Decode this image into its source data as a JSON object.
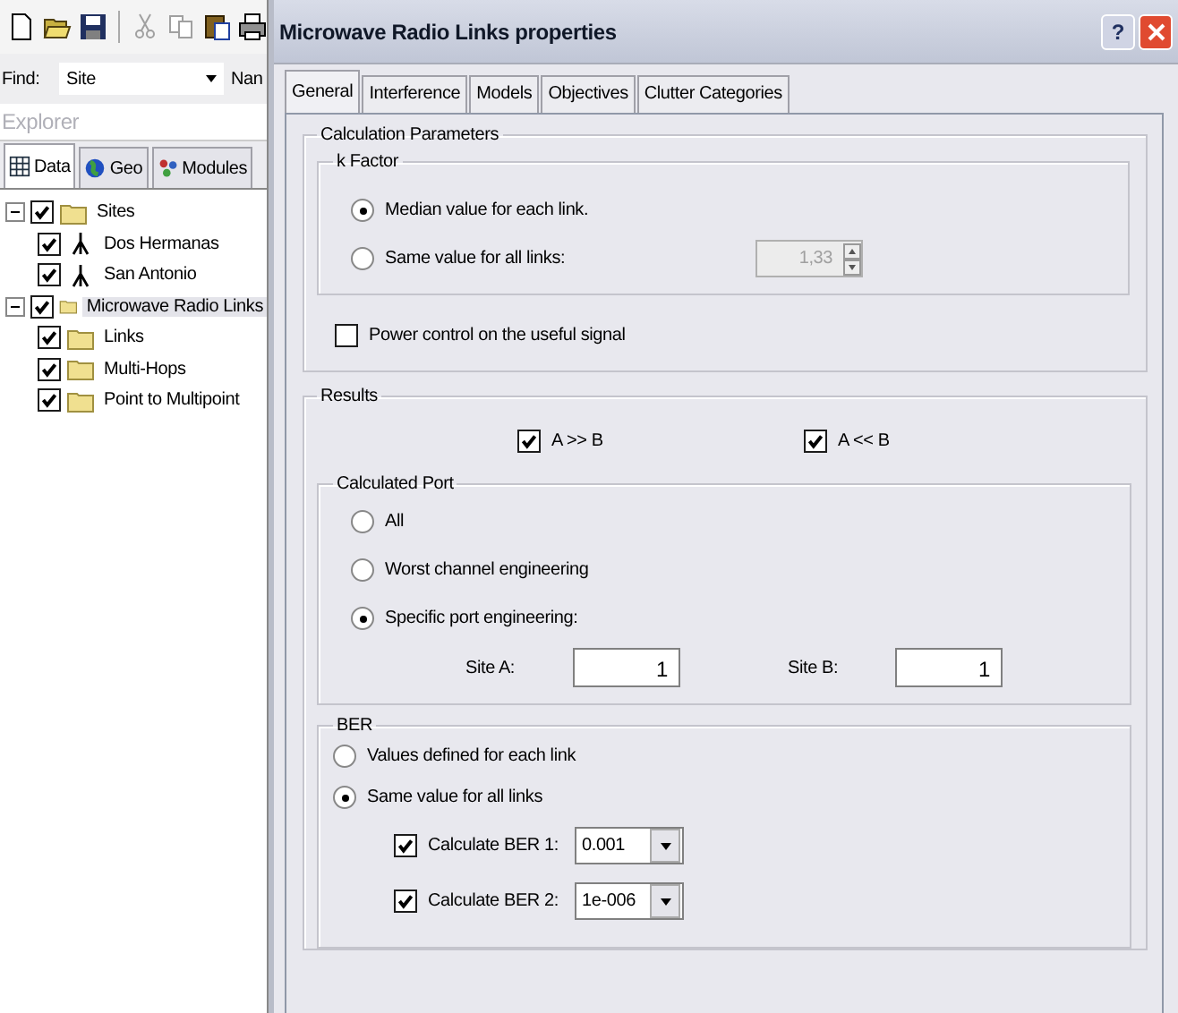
{
  "explorer": {
    "find": {
      "label": "Find:",
      "value": "Site"
    },
    "column_2_label": "Nan",
    "title": "Explorer",
    "tabs": [
      {
        "label": "Data",
        "selected": true
      },
      {
        "label": "Geo",
        "selected": false
      },
      {
        "label": "Modules",
        "selected": false
      }
    ],
    "tree": [
      {
        "label": "Sites",
        "kind": "folder",
        "checked": true,
        "expanded": true,
        "selected": false,
        "children": [
          {
            "label": "Dos Hermanas",
            "kind": "site",
            "checked": true,
            "selected": false
          },
          {
            "label": "San Antonio",
            "kind": "site",
            "checked": true,
            "selected": false
          }
        ]
      },
      {
        "label": "Microwave Radio Links",
        "kind": "folder",
        "checked": true,
        "expanded": true,
        "selected": true,
        "children": [
          {
            "label": "Links",
            "kind": "folder",
            "checked": true,
            "selected": false
          },
          {
            "label": "Multi-Hops",
            "kind": "folder",
            "checked": true,
            "selected": false
          },
          {
            "label": "Point to Multipoint",
            "kind": "folder",
            "checked": true,
            "selected": false
          }
        ]
      }
    ]
  },
  "dialog": {
    "title": "Microwave Radio Links properties",
    "help_button": "?",
    "tabs": [
      {
        "label": "General",
        "selected": true
      },
      {
        "label": "Interference",
        "selected": false
      },
      {
        "label": "Models",
        "selected": false
      },
      {
        "label": "Objectives",
        "selected": false
      },
      {
        "label": "Clutter Categories",
        "selected": false
      }
    ],
    "calculation_parameters": {
      "title": "Calculation Parameters",
      "k_factor": {
        "title": "k Factor",
        "options": [
          {
            "label": "Median value for each link.",
            "selected": true
          },
          {
            "label": "Same value for all links:",
            "selected": false
          }
        ],
        "spinner": {
          "value": "1,33",
          "disabled": true
        }
      },
      "power_control": {
        "label": "Power control on the useful signal",
        "checked": false
      }
    },
    "results": {
      "title": "Results",
      "directions": [
        {
          "label": "A >> B",
          "checked": true
        },
        {
          "label": "A << B",
          "checked": true
        }
      ],
      "calculated_port": {
        "title": "Calculated Port",
        "options": [
          {
            "label": "All",
            "selected": false
          },
          {
            "label": "Worst channel engineering",
            "selected": false
          },
          {
            "label": "Specific port engineering:",
            "selected": true
          }
        ],
        "sites": [
          {
            "label": "Site A:",
            "value": "1"
          },
          {
            "label": "Site B:",
            "value": "1"
          }
        ]
      },
      "ber": {
        "title": "BER",
        "options": [
          {
            "label": "Values defined for each link",
            "selected": false
          },
          {
            "label": "Same value for all links",
            "selected": true
          }
        ],
        "thresholds": [
          {
            "label": "Calculate BER 1:",
            "checked": true,
            "value": "0.001"
          },
          {
            "label": "Calculate BER 2:",
            "checked": true,
            "value": "1e-006"
          }
        ]
      }
    }
  }
}
